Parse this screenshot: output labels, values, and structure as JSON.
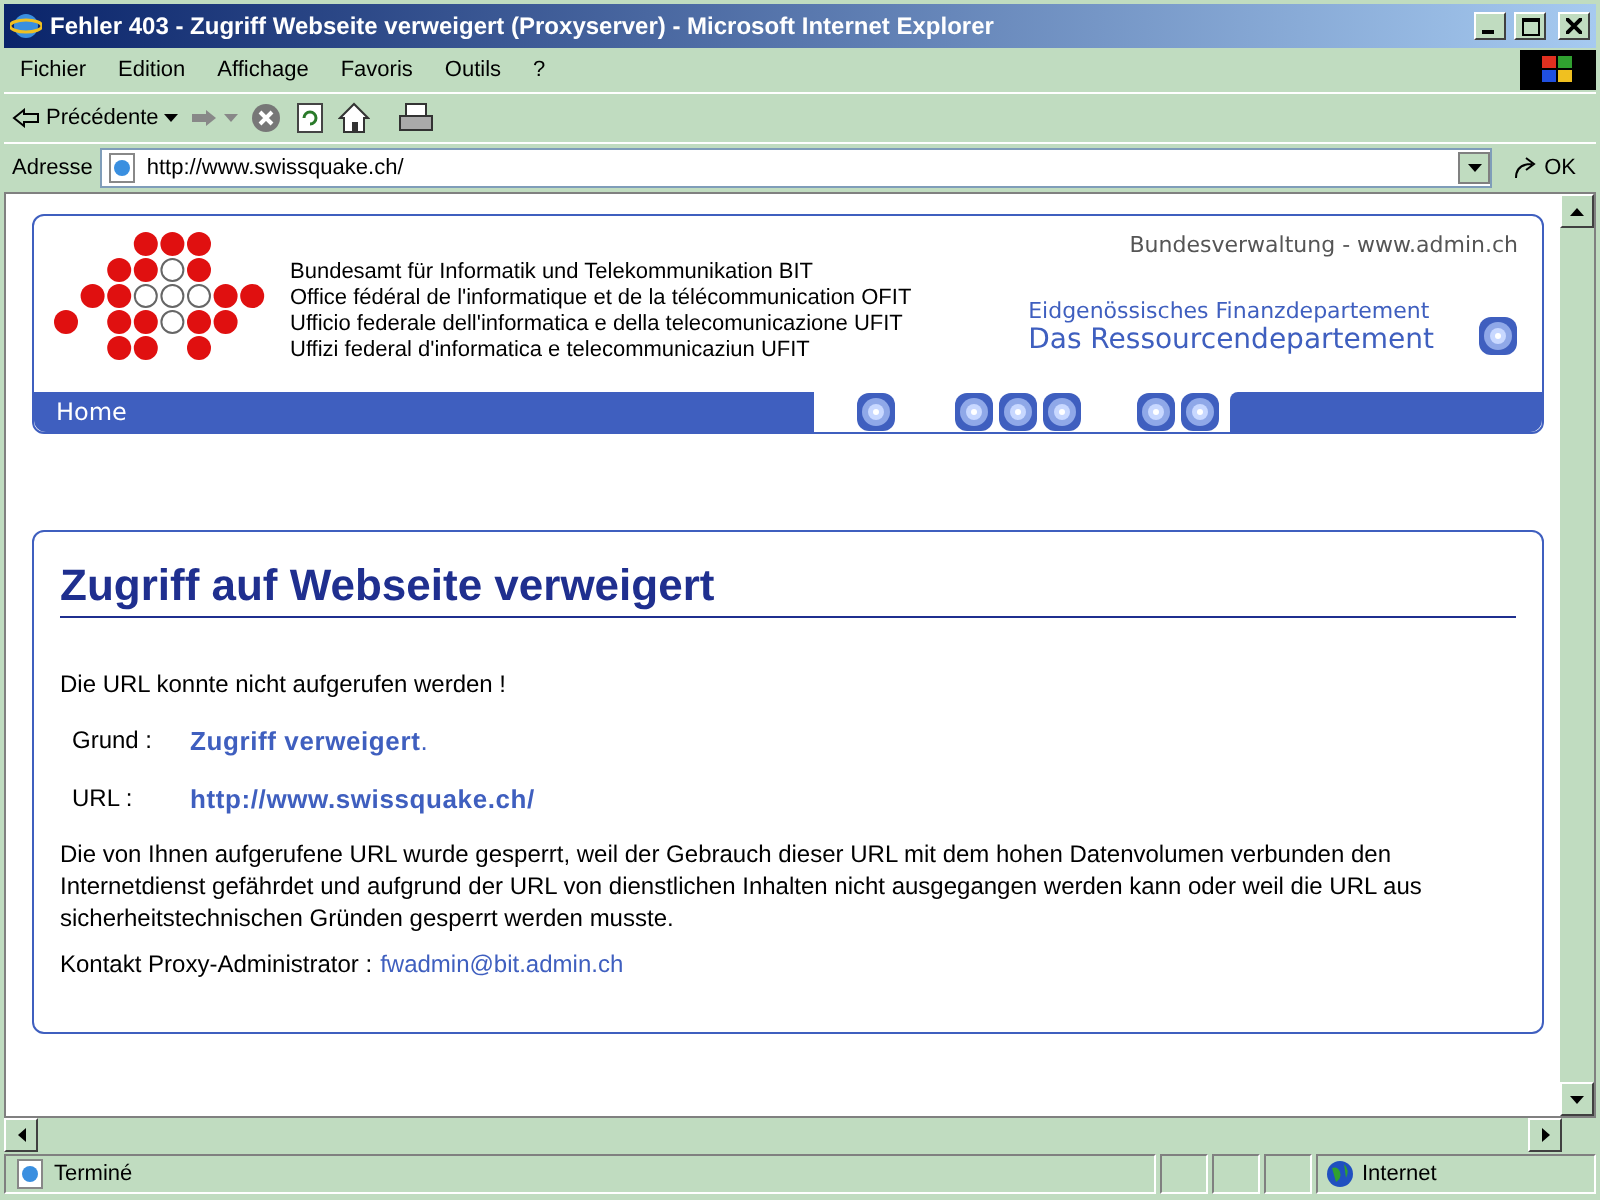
{
  "window": {
    "title": "Fehler 403 - Zugriff Webseite verweigert (Proxyserver) - Microsoft Internet Explorer"
  },
  "menu": [
    "Fichier",
    "Edition",
    "Affichage",
    "Favoris",
    "Outils",
    "?"
  ],
  "toolbar": {
    "back_label": "Précédente"
  },
  "address": {
    "label": "Adresse",
    "value": "http://www.swissquake.ch/",
    "go_label": "OK"
  },
  "page": {
    "header": {
      "org_lines": [
        "Bundesamt für Informatik und Telekommunikation BIT",
        "Office fédéral de l'informatique et de la télécommunication OFIT",
        "Ufficio federale dell'informatica e della telecomunicazione UFIT",
        "Uffizi federal d'informatica e telecommunicaziun UFIT"
      ],
      "top_link": "Bundesverwaltung - www.admin.ch",
      "department": "Eidgenössisches Finanzdepartement",
      "department_title": "Das Ressourcendepartement",
      "nav_label": "Home"
    },
    "error": {
      "heading": "Zugriff auf Webseite verweigert",
      "intro": "Die URL konnte nicht aufgerufen werden !",
      "fields": [
        {
          "label": "Grund :",
          "value": "**Zugriff verweigert**."
        },
        {
          "label": "URL :",
          "value": "**http://www.swissquake.ch/**"
        }
      ],
      "explanation": "Die von Ihnen aufgerufene URL wurde gesperrt, weil der Gebrauch dieser URL mit dem hohen Datenvolumen verbunden den Internetdienst gefährdet und aufgrund der URL von dienstlichen Inhalten nicht ausgegangen werden kann oder weil die URL aus sicherheitstechnischen Gründen gesperrt werden musste.",
      "contact_label": "Kontakt Proxy-Administrator :",
      "contact_email": "fwadmin@bit.admin.ch"
    }
  },
  "status_bar": {
    "text": "Terminé",
    "zone": "Internet"
  }
}
